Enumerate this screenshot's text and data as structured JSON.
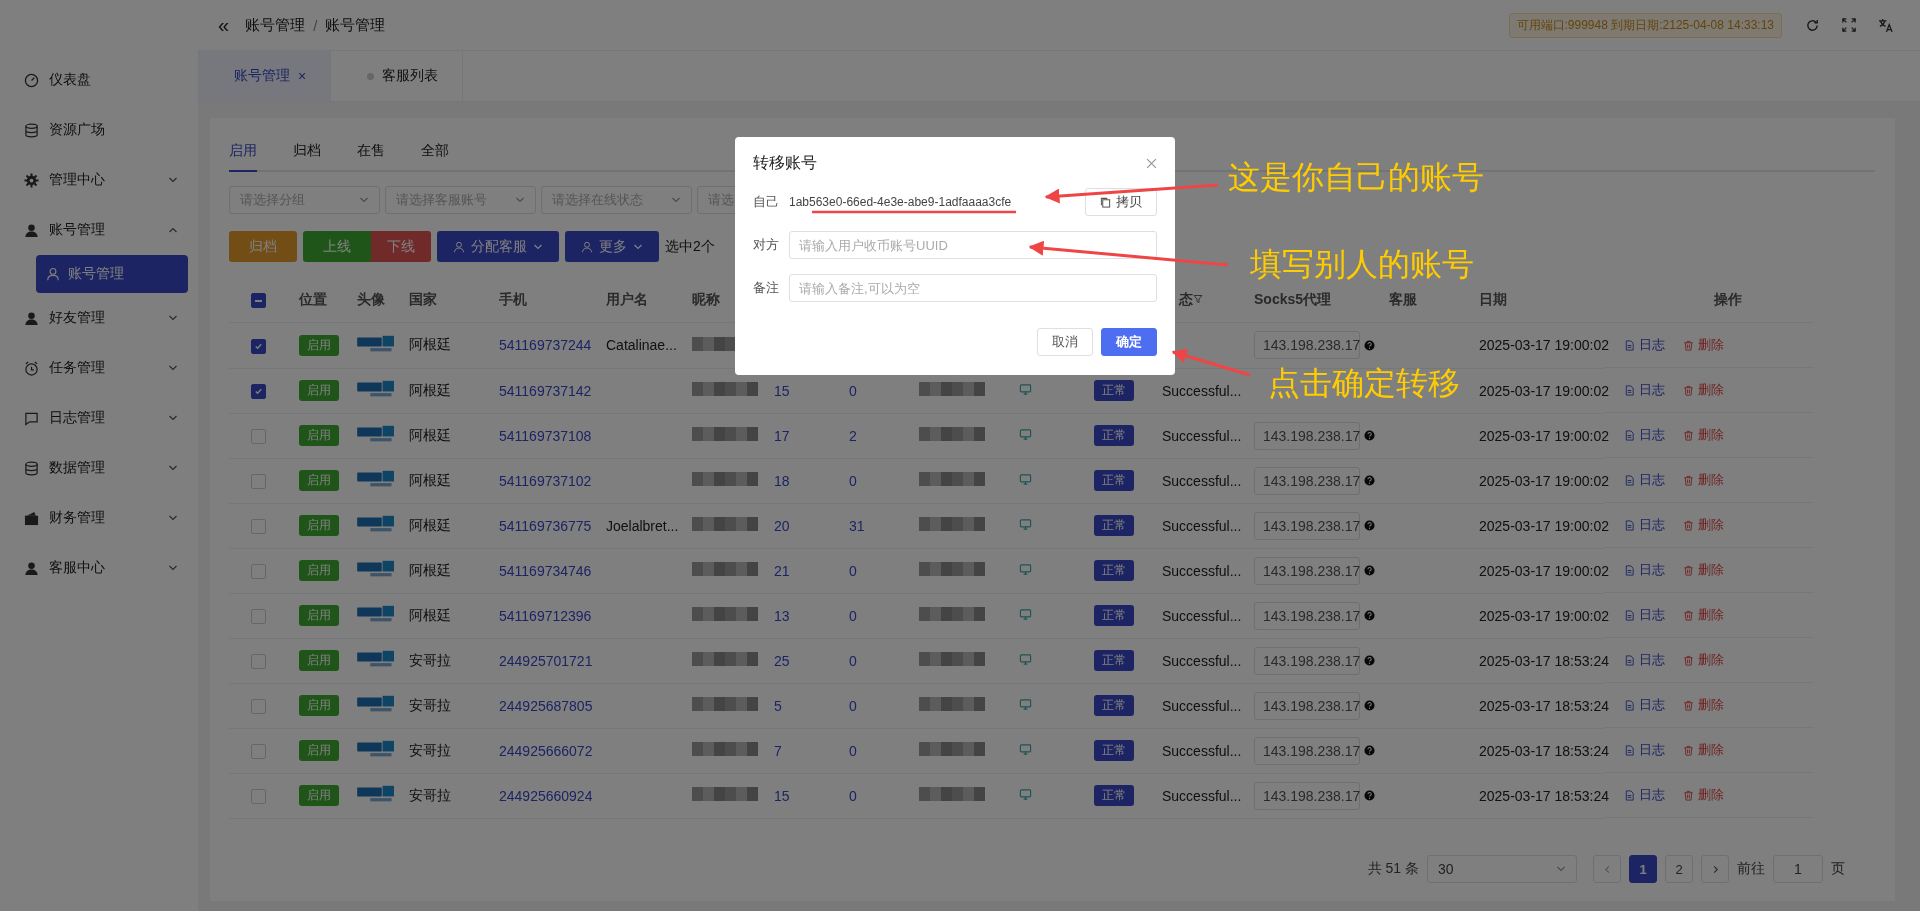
{
  "sidebar": {
    "items": [
      {
        "label": "仪表盘",
        "kind": "link"
      },
      {
        "label": "资源广场",
        "kind": "link"
      },
      {
        "label": "管理中心",
        "kind": "group",
        "expanded": false
      },
      {
        "label": "账号管理",
        "kind": "group",
        "expanded": true,
        "children": [
          {
            "label": "账号管理",
            "selected": true
          }
        ]
      },
      {
        "label": "好友管理",
        "kind": "group",
        "expanded": false
      },
      {
        "label": "任务管理",
        "kind": "group",
        "expanded": false
      },
      {
        "label": "日志管理",
        "kind": "group",
        "expanded": false
      },
      {
        "label": "数据管理",
        "kind": "group",
        "expanded": false
      },
      {
        "label": "财务管理",
        "kind": "group",
        "expanded": false
      },
      {
        "label": "客服中心",
        "kind": "group",
        "expanded": false
      }
    ]
  },
  "header": {
    "collapse_button": "«",
    "breadcrumb": [
      "账号管理",
      "/",
      "账号管理"
    ],
    "badge": "可用端口:999948 到期日期:2125-04-08 14:33:13"
  },
  "page_tabs": [
    {
      "label": "账号管理",
      "selected": true,
      "closable": true,
      "close_glyph": "×"
    },
    {
      "label": "客服列表",
      "selected": false,
      "closable": false
    }
  ],
  "tabs": [
    {
      "label": "启用",
      "selected": true
    },
    {
      "label": "归档",
      "selected": false
    },
    {
      "label": "在售",
      "selected": false
    },
    {
      "label": "全部",
      "selected": false
    }
  ],
  "filters": [
    {
      "placeholder": "请选择分组"
    },
    {
      "placeholder": "请选择客服账号"
    },
    {
      "placeholder": "请选择在线状态"
    },
    {
      "placeholder": "请选"
    }
  ],
  "actions": [
    {
      "label": "归档",
      "kind": "warning",
      "dropdown": false
    },
    {
      "label": "上线",
      "kind": "success",
      "dropdown": false
    },
    {
      "label": "下线",
      "kind": "danger",
      "dropdown": false
    },
    {
      "label": "分配客服",
      "kind": "primary",
      "dropdown": true
    },
    {
      "label": "更多",
      "kind": "primary",
      "dropdown": true
    }
  ],
  "selection_count": "选中2个",
  "table": {
    "select_all": {
      "indeterminate": true
    },
    "header": {
      "position": "位置",
      "avatar": "头像",
      "country": "国家",
      "phone": "手机",
      "username": "用户名",
      "nickname": "昵称",
      "state": "态",
      "proxy": "Socks5代理",
      "service": "客服",
      "date": "日期",
      "ops": "操作"
    },
    "rows": [
      {
        "checked": true,
        "position": "启用",
        "country": "阿根廷",
        "phone": "541169737244",
        "username": "Catalinae...",
        "proxy": "143.198.238.17",
        "date": "2025-03-17 19:00:02",
        "log": "日志",
        "delete": "删除"
      },
      {
        "checked": true,
        "position": "启用",
        "country": "阿根廷",
        "phone": "541169737142",
        "count_1": "15",
        "count_2": "0",
        "status": "正常",
        "state": "Successful...",
        "date": "2025-03-17 19:00:02",
        "log": "日志",
        "delete": "删除"
      },
      {
        "checked": false,
        "position": "启用",
        "country": "阿根廷",
        "phone": "541169737108",
        "count_1": "17",
        "count_2": "2",
        "status": "正常",
        "state": "Successful...",
        "proxy": "143.198.238.17",
        "date": "2025-03-17 19:00:02",
        "log": "日志",
        "delete": "删除"
      },
      {
        "checked": false,
        "position": "启用",
        "country": "阿根廷",
        "phone": "541169737102",
        "count_1": "18",
        "count_2": "0",
        "status": "正常",
        "state": "Successful...",
        "proxy": "143.198.238.17",
        "date": "2025-03-17 19:00:02",
        "log": "日志",
        "delete": "删除"
      },
      {
        "checked": false,
        "position": "启用",
        "country": "阿根廷",
        "phone": "541169736775",
        "username": "Joelalbret...",
        "count_1": "20",
        "count_2": "31",
        "status": "正常",
        "state": "Successful...",
        "proxy": "143.198.238.17",
        "date": "2025-03-17 19:00:02",
        "log": "日志",
        "delete": "删除"
      },
      {
        "checked": false,
        "position": "启用",
        "country": "阿根廷",
        "phone": "541169734746",
        "count_1": "21",
        "count_2": "0",
        "status": "正常",
        "state": "Successful...",
        "proxy": "143.198.238.17",
        "date": "2025-03-17 19:00:02",
        "log": "日志",
        "delete": "删除"
      },
      {
        "checked": false,
        "position": "启用",
        "country": "阿根廷",
        "phone": "541169712396",
        "count_1": "13",
        "count_2": "0",
        "status": "正常",
        "state": "Successful...",
        "proxy": "143.198.238.17",
        "date": "2025-03-17 19:00:02",
        "log": "日志",
        "delete": "删除"
      },
      {
        "checked": false,
        "position": "启用",
        "country": "安哥拉",
        "phone": "244925701721",
        "count_1": "25",
        "count_2": "0",
        "status": "正常",
        "state": "Successful...",
        "proxy": "143.198.238.17",
        "date": "2025-03-17 18:53:24",
        "log": "日志",
        "delete": "删除"
      },
      {
        "checked": false,
        "position": "启用",
        "country": "安哥拉",
        "phone": "244925687805",
        "count_1": "5",
        "count_2": "0",
        "status": "正常",
        "state": "Successful...",
        "proxy": "143.198.238.17",
        "date": "2025-03-17 18:53:24",
        "log": "日志",
        "delete": "删除"
      },
      {
        "checked": false,
        "position": "启用",
        "country": "安哥拉",
        "phone": "244925666072",
        "count_1": "7",
        "count_2": "0",
        "status": "正常",
        "state": "Successful...",
        "proxy": "143.198.238.17",
        "date": "2025-03-17 18:53:24",
        "log": "日志",
        "delete": "删除"
      },
      {
        "checked": false,
        "position": "启用",
        "country": "安哥拉",
        "phone": "244925660924",
        "count_1": "15",
        "count_2": "0",
        "status": "正常",
        "state": "Successful...",
        "proxy": "143.198.238.17",
        "date": "2025-03-17 18:53:24",
        "log": "日志",
        "delete": "删除"
      }
    ]
  },
  "pagination": {
    "total": "共 51 条",
    "page_size": "30",
    "pages": [
      {
        "label": "1",
        "selected": true
      },
      {
        "label": "2",
        "selected": false
      }
    ],
    "goto_label": "前往",
    "goto_value": "1",
    "page_unit": "页"
  },
  "dialog": {
    "title": "转移账号",
    "own_label": "自己",
    "own_value": "1ab563e0-66ed-4e3e-abe9-1adfaaaa3cfe",
    "copy_button": "拷贝",
    "target_label": "对方",
    "target_placeholder": "请输入用户收币账号UUID",
    "note_label": "备注",
    "note_placeholder": "请输入备注,可以为空",
    "cancel": "取消",
    "confirm": "确定"
  },
  "annotations": [
    {
      "text": "这是你自己的账号"
    },
    {
      "text": "填写别人的账号"
    },
    {
      "text": "点击确定转移"
    }
  ]
}
